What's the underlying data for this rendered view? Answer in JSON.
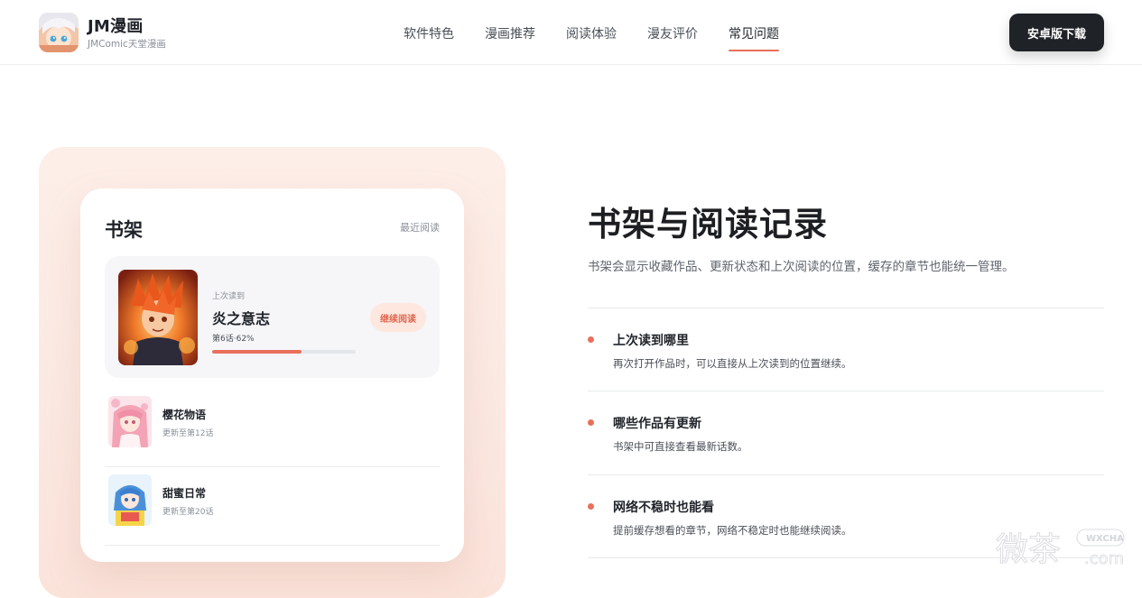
{
  "header": {
    "brand_name": "JM漫画",
    "brand_sub": "JMComic天堂漫画",
    "nav": [
      "软件特色",
      "漫画推荐",
      "阅读体验",
      "漫友评价",
      "常见问题"
    ],
    "active_nav": "常见问题",
    "download_label": "安卓版下载"
  },
  "shelf": {
    "title": "书架",
    "recent_link": "最近阅读",
    "current": {
      "label": "上次读到",
      "title": "炎之意志",
      "progress_text": "第6话·62%",
      "progress": 0.62,
      "continue_label": "继续阅读"
    },
    "items": [
      {
        "title": "樱花物语",
        "subtitle": "更新至第12话"
      },
      {
        "title": "甜蜜日常",
        "subtitle": "更新至第20话"
      }
    ]
  },
  "main": {
    "heading": "书架与阅读记录",
    "subheading": "书架会显示收藏作品、更新状态和上次阅读的位置，缓存的章节也能统一管理。",
    "features": [
      {
        "title": "上次读到哪里",
        "desc": "再次打开作品时，可以直接从上次读到的位置继续。"
      },
      {
        "title": "哪些作品有更新",
        "desc": "书架中可直接查看最新话数。"
      },
      {
        "title": "网络不稳时也能看",
        "desc": "提前缓存想看的章节，网络不稳定时也能继续阅读。"
      }
    ]
  },
  "watermark": {
    "text_main": "微茶",
    "text_tag": "WXCHA",
    "text_domain": ".com"
  },
  "colors": {
    "accent": "#e8705a",
    "dark_button": "#1f2226",
    "showcase_bg": "#fdeee8"
  }
}
